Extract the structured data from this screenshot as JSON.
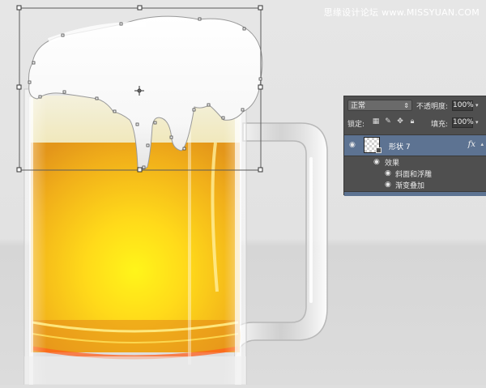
{
  "watermark": "思缘设计论坛 www.MISSYUAN.COM",
  "layers_panel": {
    "blend_mode": "正常",
    "opacity_label": "不透明度:",
    "opacity_value": "100%",
    "lock_label": "锁定:",
    "fill_label": "填充:",
    "fill_value": "100%",
    "layer": {
      "name": "形状 7",
      "fx_label": "fx",
      "effects_group": "效果",
      "effects": [
        "斜面和浮雕",
        "渐变叠加"
      ]
    },
    "colors": {
      "panel_bg": "#4f4f4f",
      "selected_row": "#5d7392"
    }
  },
  "canvas": {
    "colors": {
      "background": "#dedede",
      "beer_light": "#ffe500",
      "beer_dark": "#e08a00",
      "foam": "#ffffff"
    }
  }
}
